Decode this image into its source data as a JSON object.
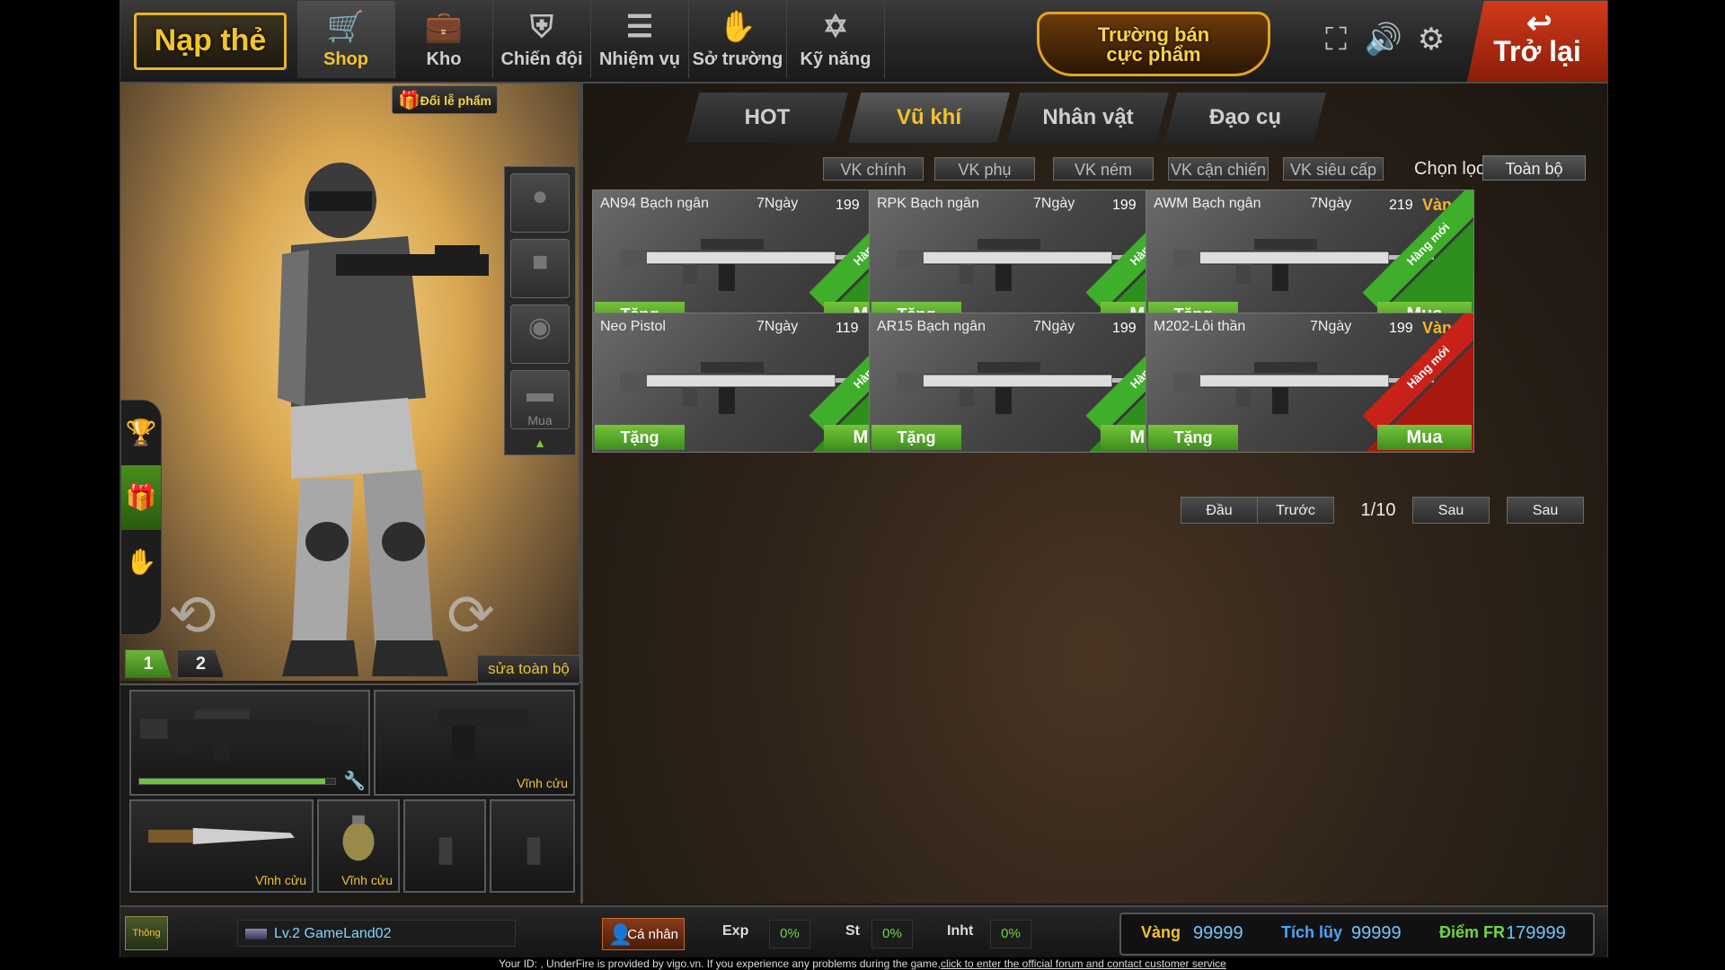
{
  "topbar": {
    "recharge_label": "Nạp thẻ",
    "tabs": [
      {
        "label": "Shop",
        "icon": "cart-icon"
      },
      {
        "label": "Kho",
        "icon": "briefcase-icon"
      },
      {
        "label": "Chiến đội",
        "icon": "shield-icon"
      },
      {
        "label": "Nhiệm vụ",
        "icon": "clipboard-icon"
      },
      {
        "label": "Sở trường",
        "icon": "arm-icon"
      },
      {
        "label": "Kỹ năng",
        "icon": "star-of-david-icon"
      }
    ],
    "premium_line1": "Trường bán",
    "premium_line2": "cực phẩm",
    "back_label": "Trở lại"
  },
  "left": {
    "gift_exchange_label": "Đổi lễ phẩm",
    "equip_last_label": "Mua",
    "loadout_tabs": [
      "1",
      "2"
    ],
    "repair_all_label": "sửa toàn bộ",
    "permanent_label": "Vĩnh cửu",
    "durability_fraction": 0.95
  },
  "shop": {
    "categories": [
      "HOT",
      "Vũ khí",
      "Nhân vật",
      "Đạo cụ"
    ],
    "filters": [
      "VK chính",
      "VK phụ",
      "VK ném",
      "VK cận chiến",
      "VK siêu cấp"
    ],
    "filter_label": "Chọn lọc",
    "filter_value": "Toàn bộ",
    "currency_label": "Vàng",
    "gift_label": "Tặng",
    "buy_label": "Mua",
    "new_label": "Hàng mới",
    "items": [
      {
        "name": "AN94 Bạch ngân",
        "days": "7Ngày",
        "price": "199",
        "ribbon": "green"
      },
      {
        "name": "RPK Bạch ngân",
        "days": "7Ngày",
        "price": "199",
        "ribbon": "green"
      },
      {
        "name": "AWM Bạch ngân",
        "days": "7Ngày",
        "price": "219",
        "ribbon": "green"
      },
      {
        "name": "Neo Pistol",
        "days": "7Ngày",
        "price": "119",
        "ribbon": "green"
      },
      {
        "name": "AR15 Bạch ngân",
        "days": "7Ngày",
        "price": "199",
        "ribbon": "green"
      },
      {
        "name": "M202-Lôi thần",
        "days": "7Ngày",
        "price": "199",
        "ribbon": "red"
      }
    ],
    "pager": {
      "first": "Đầu",
      "prev": "Trước",
      "page": "1/10",
      "next": "Sau",
      "last": "Sau"
    }
  },
  "bottombar": {
    "notice_label": "Thông báo",
    "player_name": "Lv.2 GameLand02",
    "profile_label": "Cá nhân",
    "exp_label": "Exp",
    "exp_value": "0%",
    "st_label": "St",
    "st_value": "0%",
    "inht_label": "Inht",
    "inht_value": "0%",
    "gold_label": "Vàng",
    "gold_value": "99999",
    "accum_label": "Tích lũy",
    "accum_value": "99999",
    "fr_label": "Điểm FR",
    "fr_value": "179999"
  },
  "footer": {
    "text": "Your ID: , UnderFire is provided by vigo.vn. If you experience any problems during the game,",
    "link": "click to enter the official forum and contact customer service"
  },
  "colors": {
    "accent_gold": "#f3c12d",
    "buy_green": "#5aa82c",
    "new_red": "#c8211a",
    "back_red": "#d23a1a"
  }
}
